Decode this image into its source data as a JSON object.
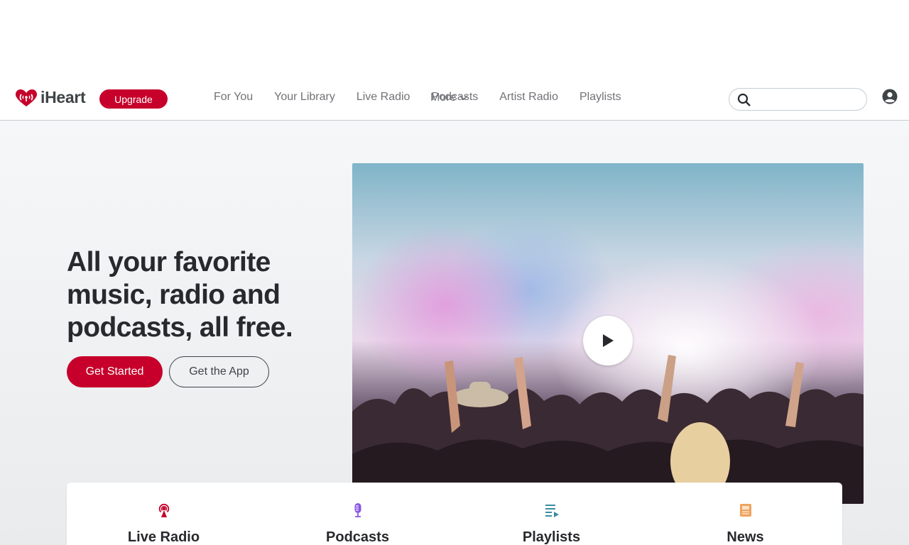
{
  "header": {
    "brand": "iHeart",
    "upgrade_label": "Upgrade",
    "brand_color": "#c6002b",
    "nav": [
      "For You",
      "Your Library",
      "Live Radio",
      "Podcasts",
      "Artist Radio",
      "Playlists"
    ],
    "more_label": "More",
    "search_placeholder": "",
    "icons": {
      "logo": "iheart-logo-icon",
      "search": "search-icon",
      "account": "account-icon",
      "more": "chevron-down-icon"
    }
  },
  "hero": {
    "headline": "All your favorite music, radio and podcasts, all free.",
    "get_started_label": "Get Started",
    "get_app_label": "Get the App",
    "video_icon": "play-icon"
  },
  "categories": [
    {
      "label": "Live Radio",
      "icon": "radio-tower-icon",
      "color": "#c6002b"
    },
    {
      "label": "Podcasts",
      "icon": "microphone-icon",
      "color": "#8a55e6"
    },
    {
      "label": "Playlists",
      "icon": "playlist-icon",
      "color": "#3a8ea0"
    },
    {
      "label": "News",
      "icon": "newspaper-icon",
      "color": "#f0a25e"
    }
  ]
}
